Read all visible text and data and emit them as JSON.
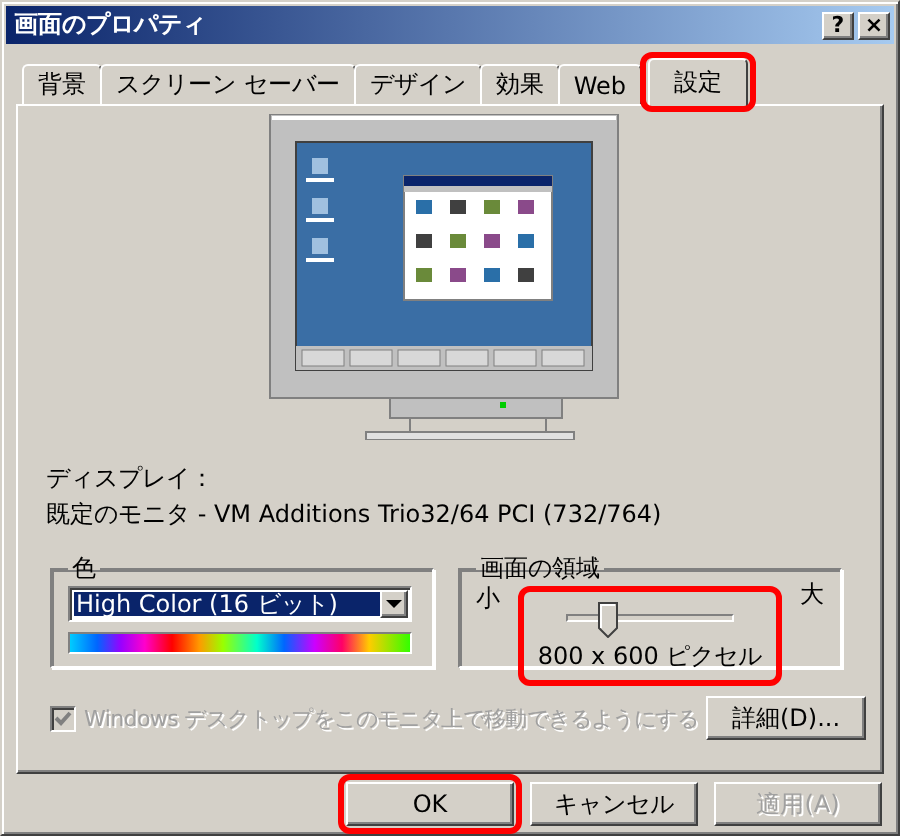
{
  "window": {
    "title": "画面のプロパティ",
    "buttons": [
      "?",
      "×"
    ]
  },
  "tabs": [
    {
      "label": "背景",
      "selected": false,
      "highlighted": false
    },
    {
      "label": "スクリーン セーバー",
      "selected": false,
      "highlighted": false
    },
    {
      "label": "デザイン",
      "selected": false,
      "highlighted": false
    },
    {
      "label": "効果",
      "selected": false,
      "highlighted": false
    },
    {
      "label": "Web",
      "selected": false,
      "highlighted": false
    },
    {
      "label": "設定",
      "selected": true,
      "highlighted": true
    }
  ],
  "display": {
    "label": "ディスプレイ：",
    "value": "既定のモニタ - VM Additions Trio32/64 PCI (732/764)"
  },
  "colors": {
    "title": "色",
    "value": "High Color (16 ビット)"
  },
  "screen_area": {
    "title": "画面の領域",
    "min_label": "小",
    "max_label": "大",
    "level": 0.25,
    "reading": "800 x 600 ピクセル",
    "highlighted": true
  },
  "move_desktop": {
    "label": "Windows デスクトップをこのモニタ上で移動できるようにする",
    "checked": true,
    "disabled": true
  },
  "advanced_button": "詳細(D)...",
  "buttons": [
    {
      "label": "OK",
      "disabled": false,
      "highlighted": true
    },
    {
      "label": "キャンセル",
      "disabled": false,
      "highlighted": false
    },
    {
      "label": "適用(A)",
      "disabled": true,
      "highlighted": false
    }
  ]
}
